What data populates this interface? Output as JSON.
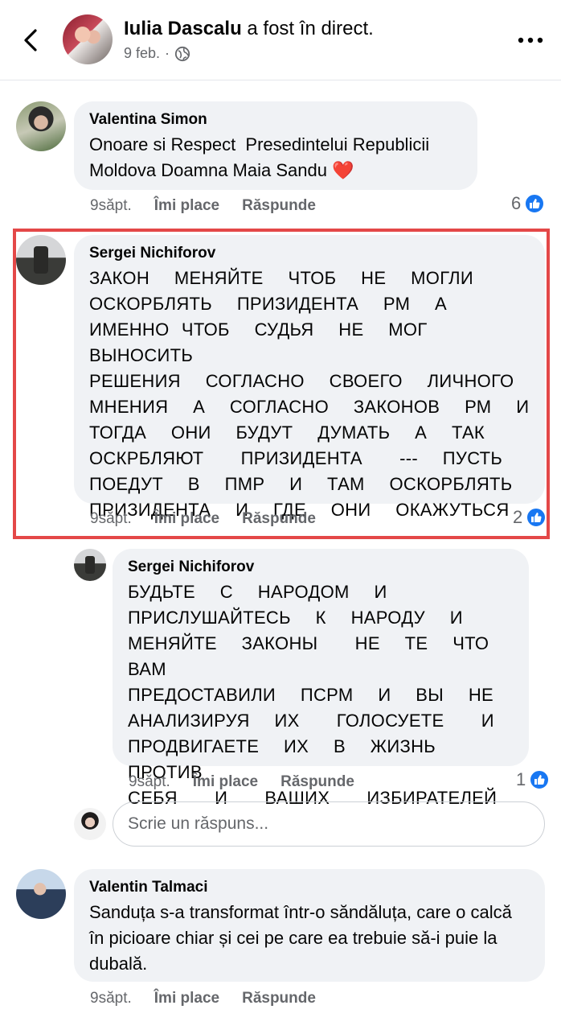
{
  "header": {
    "author": "Iulia Dascalu",
    "action": " a fost în direct.",
    "date": "9 feb.",
    "separator": "·"
  },
  "comments": [
    {
      "author": "Valentina Simon",
      "text": "Onoare si Respect  Presedintelui Republicii Moldova Doamna Maia Sandu ❤️",
      "time": "9săpt.",
      "like": "Îmi place",
      "reply": "Răspunde",
      "reactions": "6"
    },
    {
      "author": "Sergei Nichiforov",
      "text": "ЗАКОН  МЕНЯЙТЕ  ЧТОБ  НЕ  МОГЛИ\nОСКОРБЛЯТЬ  ПРИЗИДЕНТА  РМ  А\nИМЕННО ЧТОБ  СУДЬЯ  НЕ  МОГ  ВЫНОСИТЬ\nРЕШЕНИЯ  СОГЛАСНО  СВОЕГО  ЛИЧНОГО\nМНЕНИЯ  А  СОГЛАСНО  ЗАКОНОВ  РМ  И\nТОГДА  ОНИ  БУДУТ  ДУМАТЬ  А  ТАК\nОСКРБЛЯЮТ   ПРИЗИДЕНТА   ---  ПУСТЬ\nПОЕДУТ  В  ПМР  И  ТАМ  ОСКОРБЛЯТЬ\nПРИЗИДЕНТА  И  ГДЕ  ОНИ  ОКАЖУТЬСЯ",
      "time": "9săpt.",
      "like": "Îmi place",
      "reply": "Răspunde",
      "reactions": "2"
    },
    {
      "author": "Sergei Nichiforov",
      "text": "БУДЬТЕ  С  НАРОДОМ  И\nПРИСЛУШАЙТЕСЬ  К  НАРОДУ  И\nМЕНЯЙТЕ  ЗАКОНЫ   НЕ  ТЕ  ЧТО  ВАМ\nПРЕДОСТАВИЛИ  ПСРМ  И  ВЫ  НЕ\nАНАЛИЗИРУЯ  ИХ   ГОЛОСУЕТЕ   И\nПРОДВИГАЕТЕ  ИХ  В  ЖИЗНЬ  ПРОТИВ\nСЕБЯ   И   ВАШИХ   ИЗБИРАТЕЛЕЙ",
      "time": "9săpt.",
      "like": "Îmi place",
      "reply": "Răspunde",
      "reactions": "1"
    },
    {
      "author": "Valentin Talmaci",
      "text": "Sanduța s-a transformat într-o săndăluța, care o calcă în picioare chiar și cei pe care ea trebuie să-i puie la dubală.",
      "time": "9săpt.",
      "like": "Îmi place",
      "reply": "Răspunde"
    }
  ],
  "reply_box": {
    "placeholder": "Scrie un răspuns..."
  },
  "colors": {
    "accent": "#1877f2",
    "highlight": "#e44848",
    "bubble": "#f0f2f5",
    "secondary_text": "#65676b"
  },
  "icons": [
    "back-arrow-icon",
    "globe-icon",
    "more-icon",
    "like-icon"
  ]
}
